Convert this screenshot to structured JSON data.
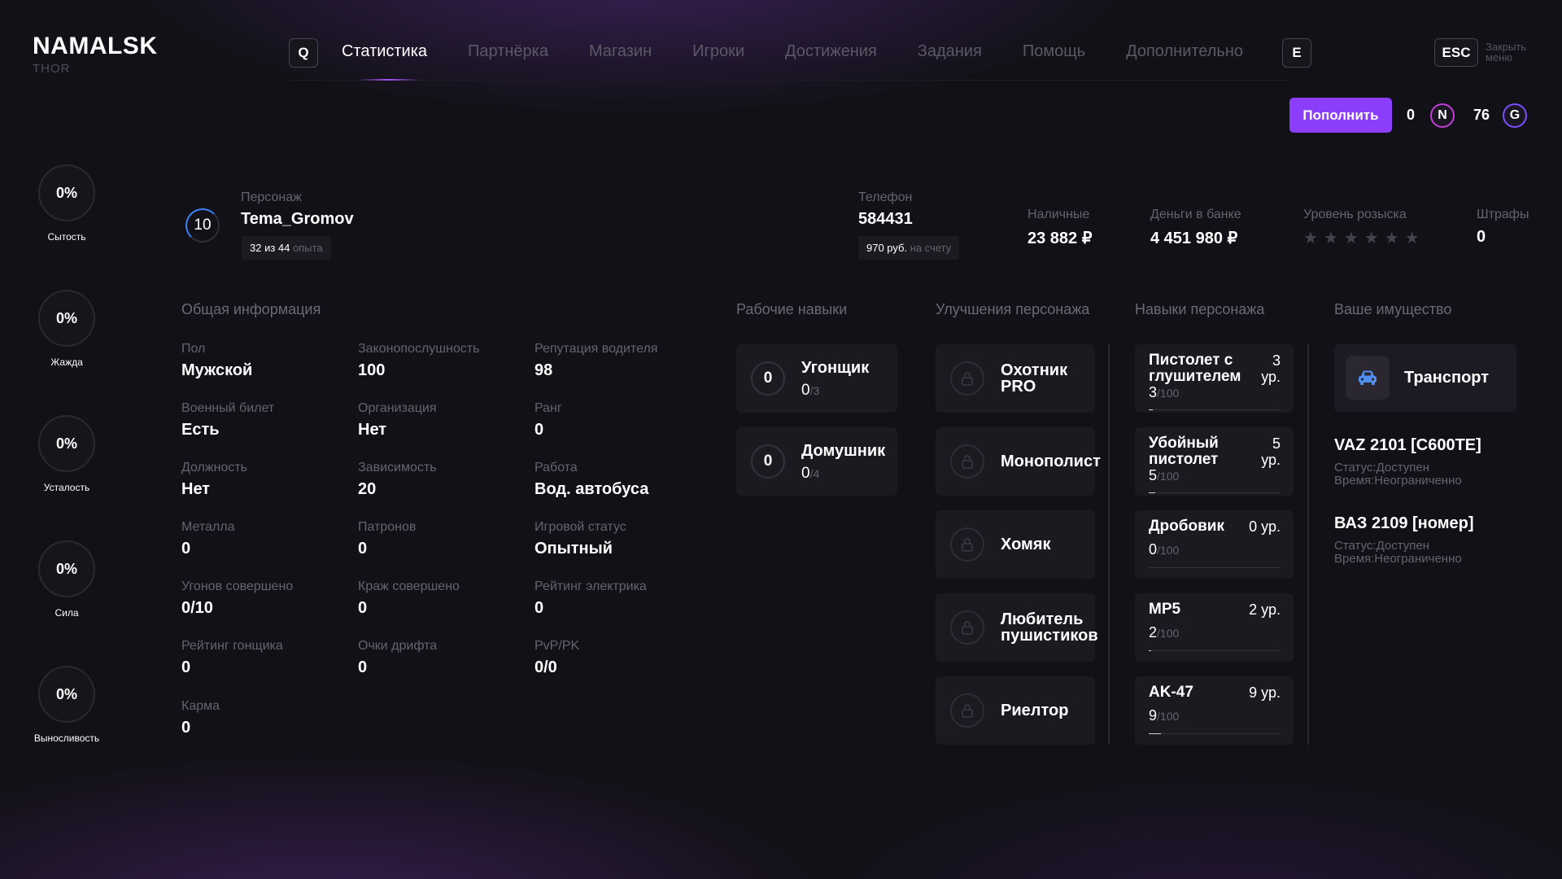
{
  "app": {
    "title": "NAMALSK",
    "subtitle": "THOR"
  },
  "nav": {
    "left_key": "Q",
    "right_key": "E",
    "items": [
      {
        "label": "Статистика",
        "active": true
      },
      {
        "label": "Партнёрка"
      },
      {
        "label": "Магазин"
      },
      {
        "label": "Игроки"
      },
      {
        "label": "Достижения"
      },
      {
        "label": "Задания"
      },
      {
        "label": "Помощь"
      },
      {
        "label": "Дополнительно"
      }
    ],
    "close_key": "ESC",
    "close_label_1": "Закрыть",
    "close_label_2": "меню"
  },
  "balance": {
    "topup_label": "Пополнить",
    "n_amount": "0",
    "n_symbol": "N",
    "g_amount": "76",
    "g_symbol": "G"
  },
  "needs": [
    {
      "value": "0%",
      "label": "Сытость"
    },
    {
      "value": "0%",
      "label": "Жажда"
    },
    {
      "value": "0%",
      "label": "Усталость"
    },
    {
      "value": "0%",
      "label": "Сила"
    },
    {
      "value": "0%",
      "label": "Выносливость"
    }
  ],
  "character": {
    "level": "10",
    "name_label": "Персонаж",
    "name": "Tema_Gromov",
    "exp_main": "32 из 44",
    "exp_suffix": "опыта",
    "phone_label": "Телефон",
    "phone": "584431",
    "phone_balance": "970 руб.",
    "phone_balance_suffix": "на счету",
    "cash_label": "Наличные",
    "cash": "23 882 ₽",
    "bank_label": "Деньги в банке",
    "bank": "4 451 980 ₽",
    "wanted_label": "Уровень розыска",
    "wanted_level": 0,
    "wanted_max": 6,
    "fines_label": "Штрафы",
    "fines": "0"
  },
  "general": {
    "title": "Общая информация",
    "fields": [
      {
        "label": "Пол",
        "value": "Мужской"
      },
      {
        "label": "Законопослушность",
        "value": "100"
      },
      {
        "label": "Репутация водителя",
        "value": "98"
      },
      {
        "label": "Военный билет",
        "value": "Есть"
      },
      {
        "label": "Организация",
        "value": "Нет"
      },
      {
        "label": "Ранг",
        "value": "0"
      },
      {
        "label": "Должность",
        "value": "Нет"
      },
      {
        "label": "Зависимость",
        "value": "20"
      },
      {
        "label": "Работа",
        "value": "Вод. автобуса"
      },
      {
        "label": "Металла",
        "value": "0"
      },
      {
        "label": "Патронов",
        "value": "0"
      },
      {
        "label": "Игровой статус",
        "value": "Опытный"
      },
      {
        "label": "Угонов совершено",
        "value": "0/10"
      },
      {
        "label": "Краж совершено",
        "value": "0"
      },
      {
        "label": "Рейтинг электрика",
        "value": "0"
      },
      {
        "label": "Рейтинг гонщика",
        "value": "0"
      },
      {
        "label": "Очки дрифта",
        "value": "0"
      },
      {
        "label": "PvP/PK",
        "value": "0/0"
      },
      {
        "label": "Карма",
        "value": "0"
      }
    ]
  },
  "work_skills": {
    "title": "Рабочие навыки",
    "items": [
      {
        "level": "0",
        "name": "Угонщик",
        "current": "0",
        "max": "/3"
      },
      {
        "level": "0",
        "name": "Домушник",
        "current": "0",
        "max": "/4"
      }
    ]
  },
  "upgrades": {
    "title": "Улучшения персонажа",
    "items": [
      {
        "line1": "Охотник",
        "line2": "PRO"
      },
      {
        "line1": "Монополист",
        "line2": ""
      },
      {
        "line1": "Хомяк",
        "line2": ""
      },
      {
        "line1": "Любитель",
        "line2": "пушистиков"
      },
      {
        "line1": "Риелтор",
        "line2": ""
      }
    ]
  },
  "char_skills": {
    "title": "Навыки персонажа",
    "items": [
      {
        "line1": "Пистолет с",
        "line2": "глушителем",
        "lvl1": "3",
        "lvl2": "ур.",
        "current": "3",
        "max": "/100",
        "progress": 0.03
      },
      {
        "line1": "Убойный",
        "line2": "пистолет",
        "lvl1": "5",
        "lvl2": "ур.",
        "current": "5",
        "max": "/100",
        "progress": 0.05
      },
      {
        "line1": "Дробовик",
        "line2": "",
        "lvl1": "0 ур.",
        "lvl2": "",
        "current": "0",
        "max": "/100",
        "progress": 0.0
      },
      {
        "line1": "MP5",
        "line2": "",
        "lvl1": "2 ур.",
        "lvl2": "",
        "current": "2",
        "max": "/100",
        "progress": 0.02
      },
      {
        "line1": "AK-47",
        "line2": "",
        "lvl1": "9 ур.",
        "lvl2": "",
        "current": "9",
        "max": "/100",
        "progress": 0.09
      }
    ]
  },
  "property": {
    "title": "Ваше имущество",
    "category": "Транспорт",
    "vehicles": [
      {
        "name": "VAZ 2101 [C600TE]",
        "status": "Статус:Доступен",
        "time": "Время:Неограниченно"
      },
      {
        "name": "ВАЗ 2109 [номер]",
        "status": "Статус:Доступен",
        "time": "Время:Неограниченно"
      }
    ]
  },
  "colors": {
    "accent": "#8b3dfa",
    "level_ring": "#3b82f6",
    "car_icon": "#4f8ff0"
  }
}
